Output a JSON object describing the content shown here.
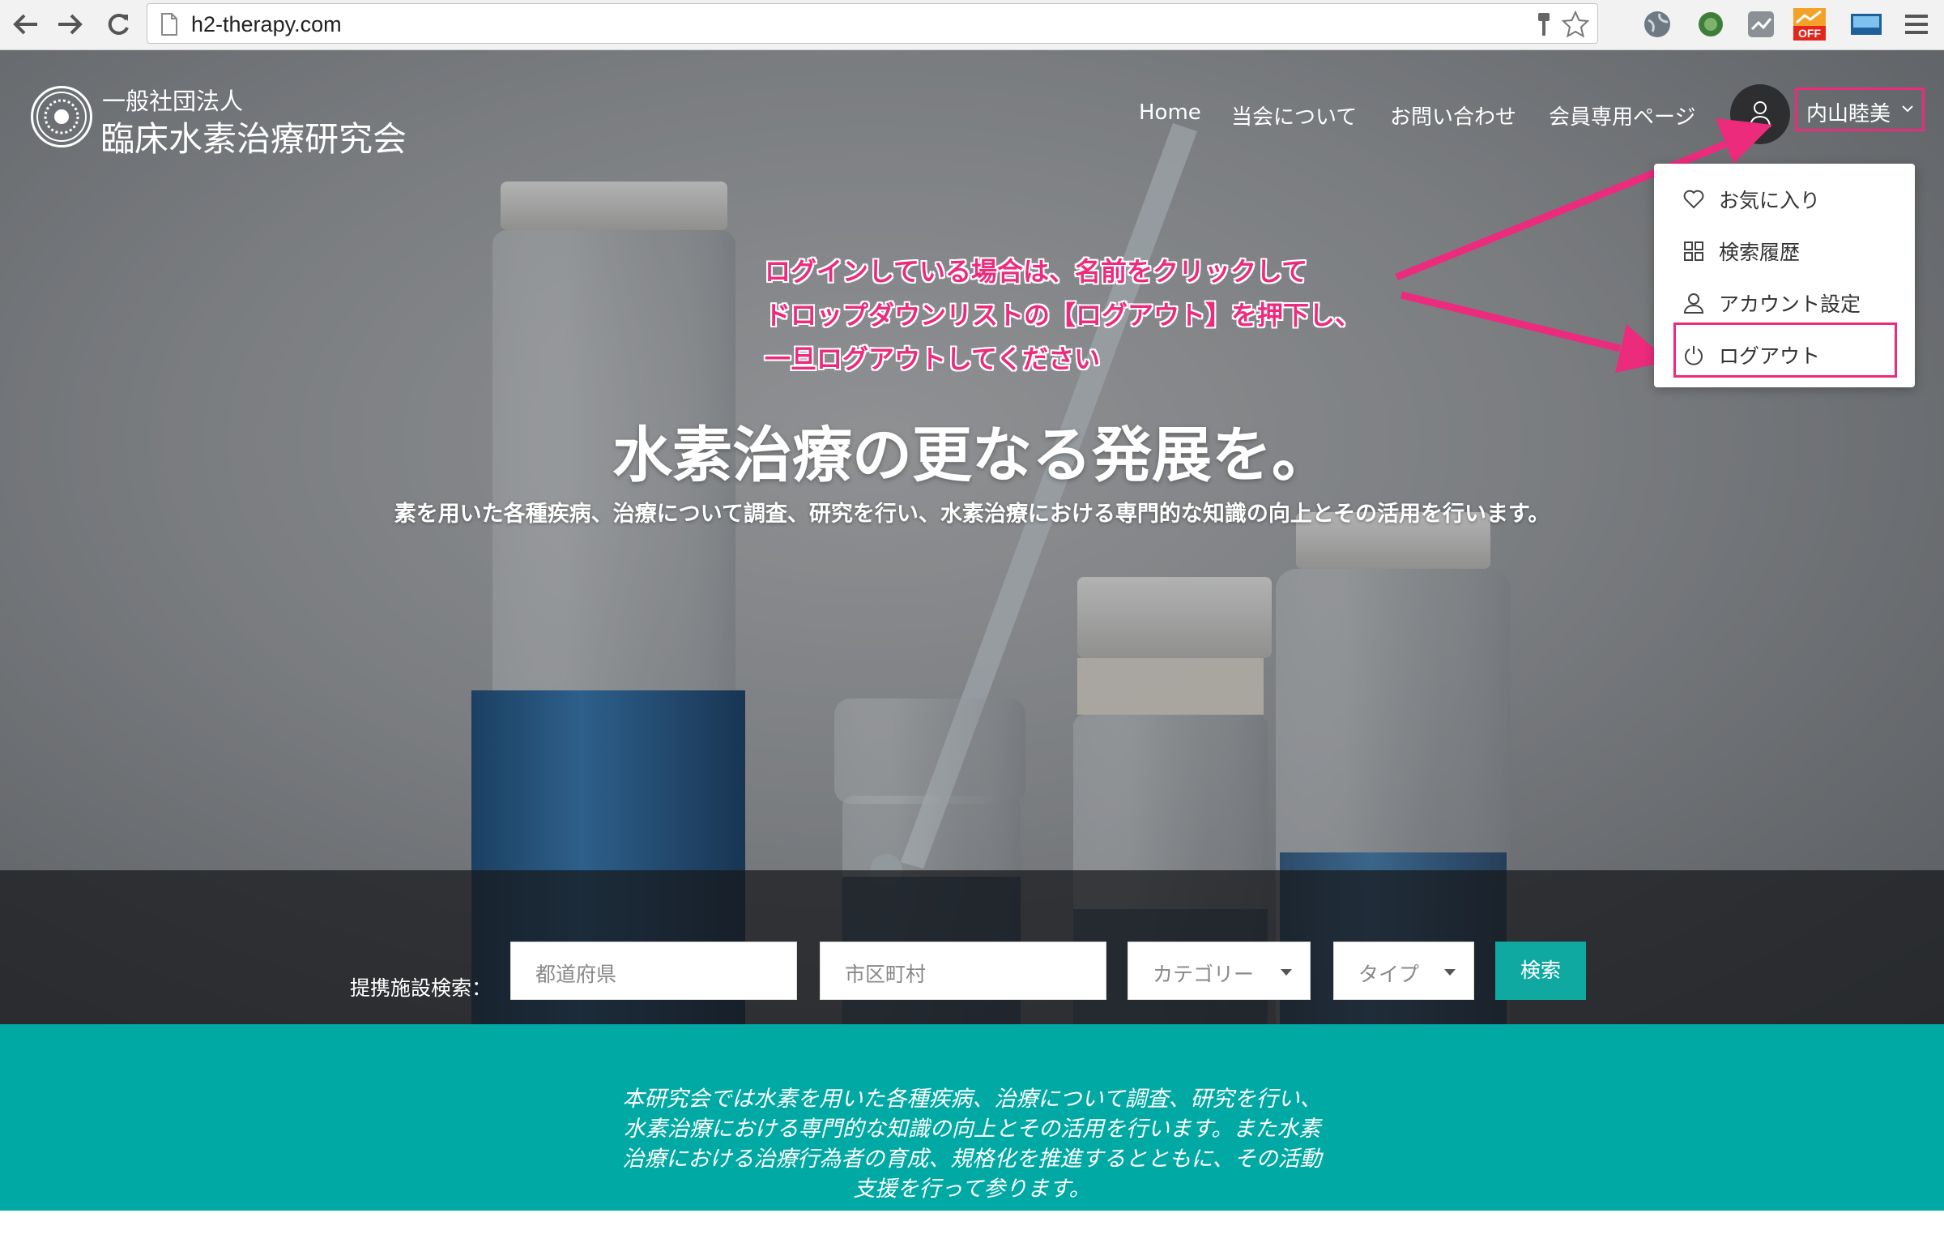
{
  "browser": {
    "url": "h2-therapy.com",
    "extension_badge": "OFF"
  },
  "site": {
    "logo_subtitle": "一般社団法人",
    "logo_title": "臨床水素治療研究会"
  },
  "nav": {
    "items": [
      {
        "label": "Home"
      },
      {
        "label": "当会について"
      },
      {
        "label": "お問い合わせ"
      },
      {
        "label": "会員専用ページ"
      }
    ],
    "user_name": "内山睦美"
  },
  "dropdown": {
    "items": [
      {
        "label": "お気に入り",
        "icon": "heart-icon"
      },
      {
        "label": "検索履歴",
        "icon": "grid-icon"
      },
      {
        "label": "アカウント設定",
        "icon": "user-icon"
      },
      {
        "label": "ログアウト",
        "icon": "power-icon"
      }
    ]
  },
  "annotation": {
    "lines": [
      "ログインしている場合は、名前をクリックして",
      "ドロップダウンリストの【ログアウト】を押下し、",
      "一旦ログアウトしてください"
    ],
    "color": "#ec2b7d"
  },
  "hero": {
    "title": "水素治療の更なる発展を。",
    "subtitle": "素を用いた各種疾病、治療について調査、研究を行い、水素治療における専門的な知識の向上とその活用を行います。"
  },
  "search": {
    "label": "提携施設検索：",
    "prefecture_placeholder": "都道府県",
    "city_placeholder": "市区町村",
    "category_value": "カテゴリー",
    "type_value": "タイプ",
    "button_label": "検索"
  },
  "about": {
    "lines": [
      "本研究会では水素を用いた各種疾病、治療について調査、研究を行い、",
      "水素治療における専門的な知識の向上とその活用を行います。また水素",
      "治療における治療行為者の育成、規格化を推進するとともに、その活動",
      "支援を行って参ります。"
    ]
  },
  "colors": {
    "accent": "#00a9a3",
    "highlight": "#ec2b7d"
  }
}
